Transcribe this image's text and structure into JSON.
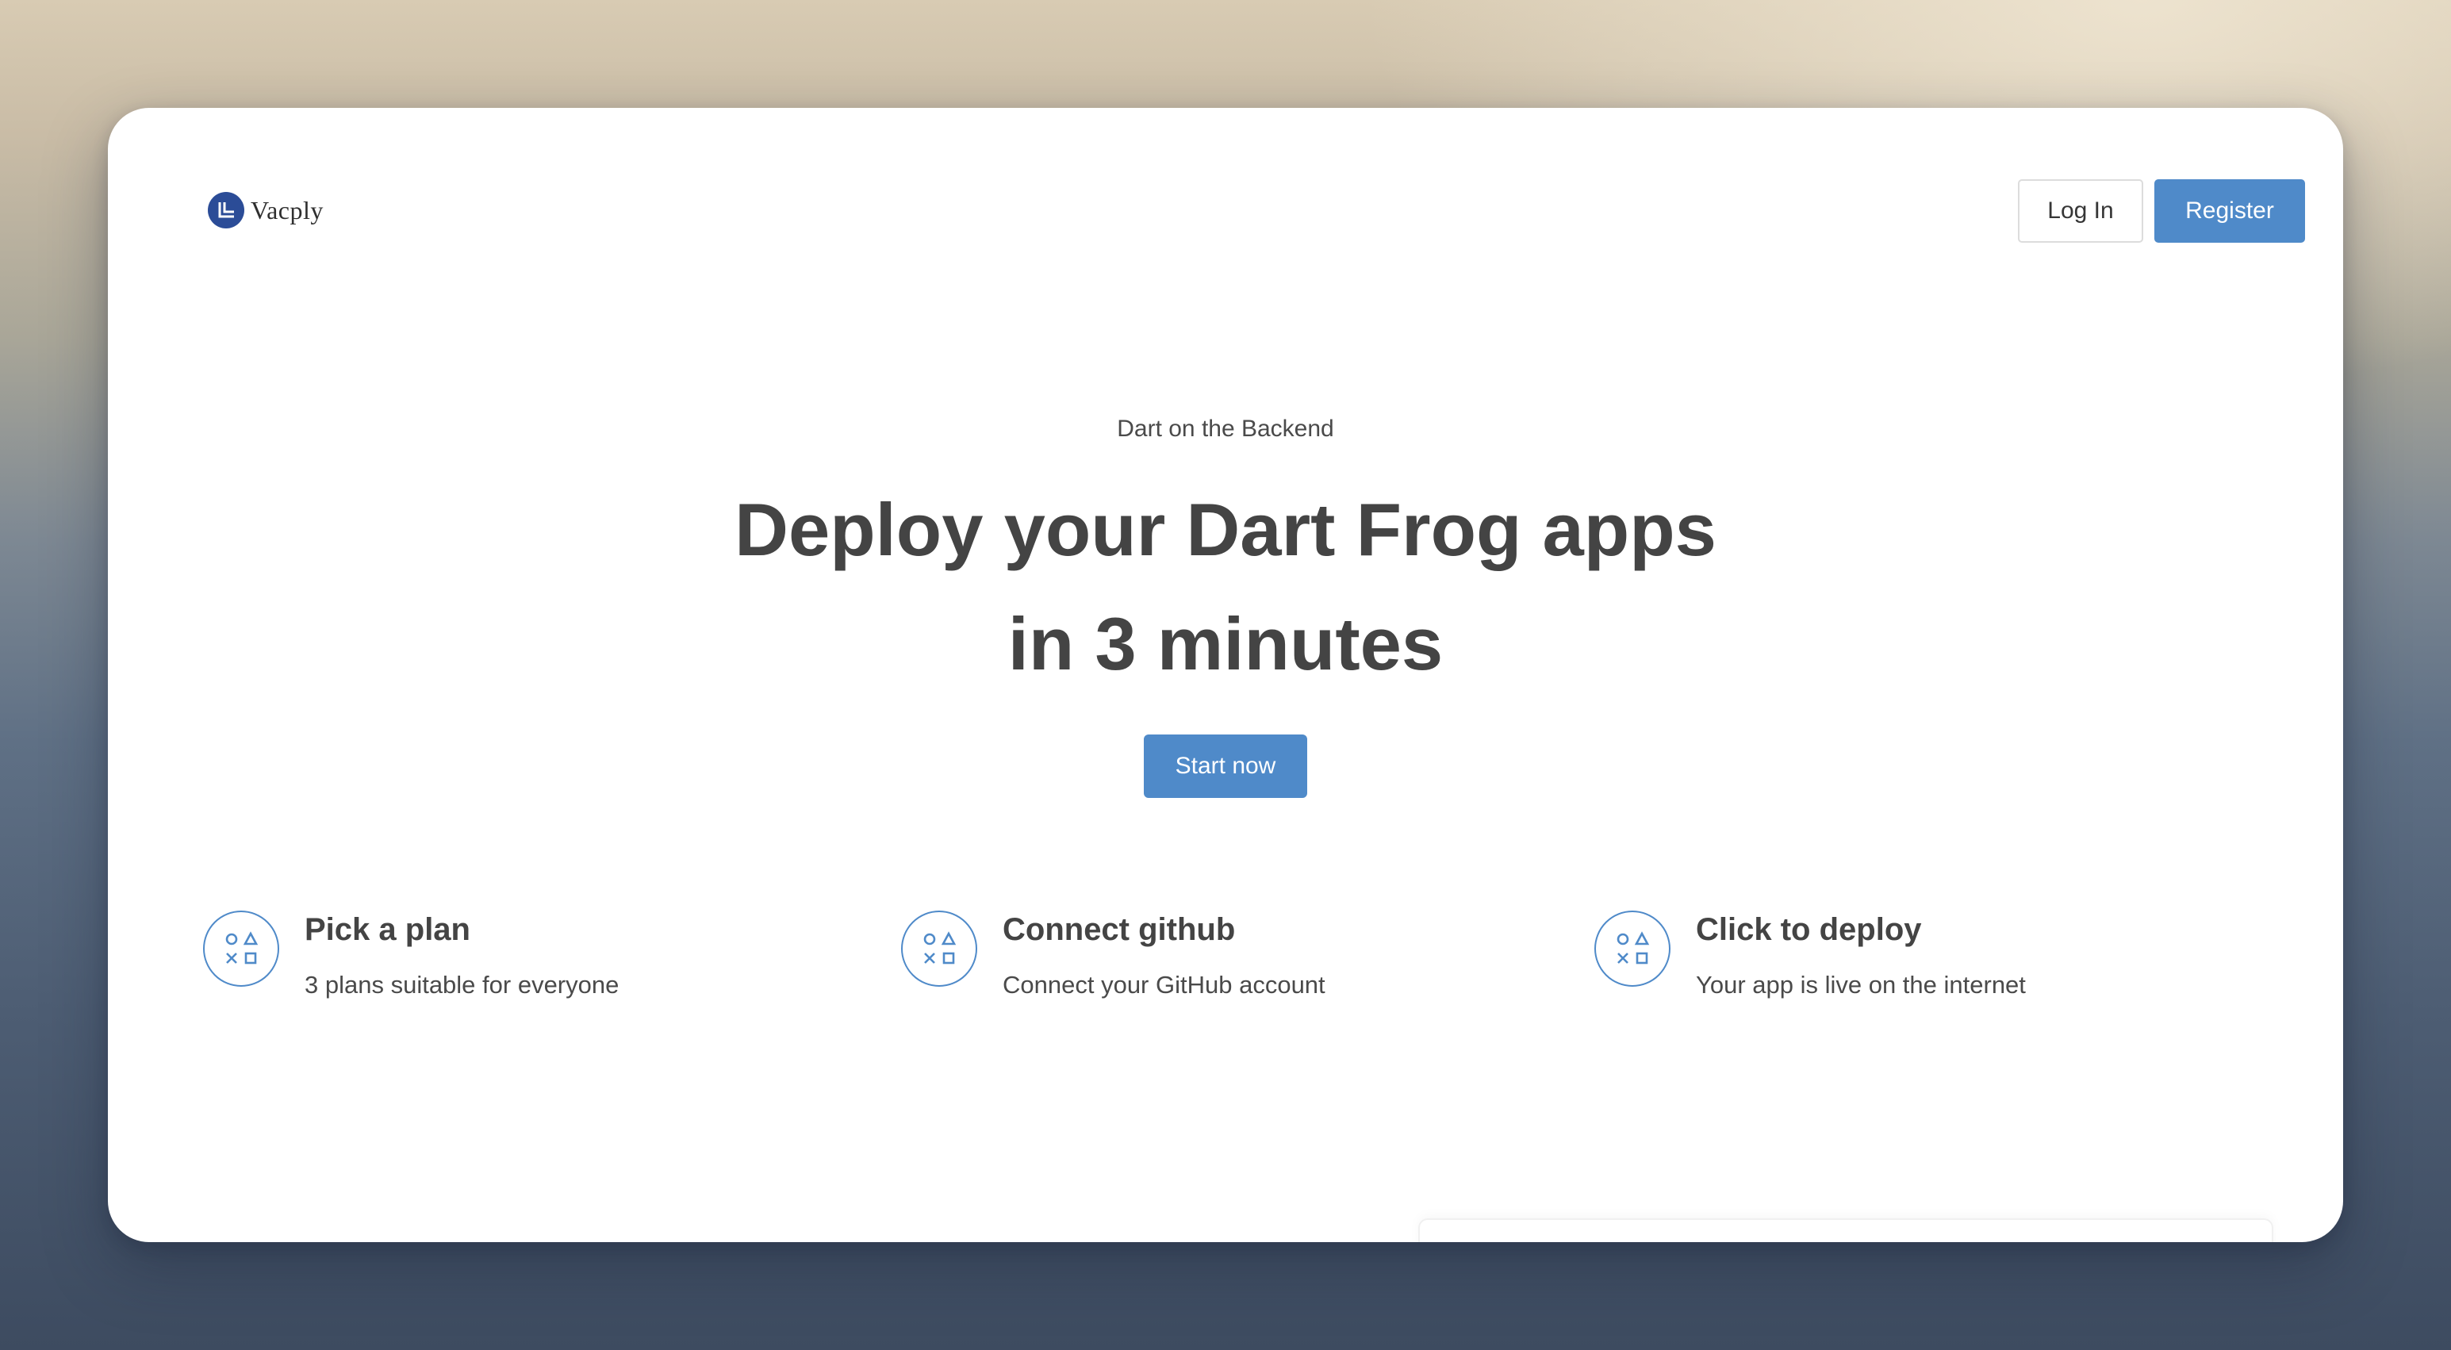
{
  "brand": {
    "name": "Vacply",
    "logo_icon": "vacply-logo-icon",
    "accent_color": "#4f8ac9",
    "logo_color": "#2b4c97"
  },
  "header": {
    "login_label": "Log In",
    "register_label": "Register"
  },
  "hero": {
    "eyebrow": "Dart on the Backend",
    "title_line1": "Deploy your Dart Frog apps",
    "title_line2": "in 3 minutes",
    "cta_label": "Start now"
  },
  "features": [
    {
      "icon": "shapes-icon",
      "title": "Pick a plan",
      "description": "3 plans suitable for everyone"
    },
    {
      "icon": "shapes-icon",
      "title": "Connect github",
      "description": "Connect your GitHub account"
    },
    {
      "icon": "shapes-icon",
      "title": "Click to deploy",
      "description": "Your app is live on the internet"
    }
  ]
}
